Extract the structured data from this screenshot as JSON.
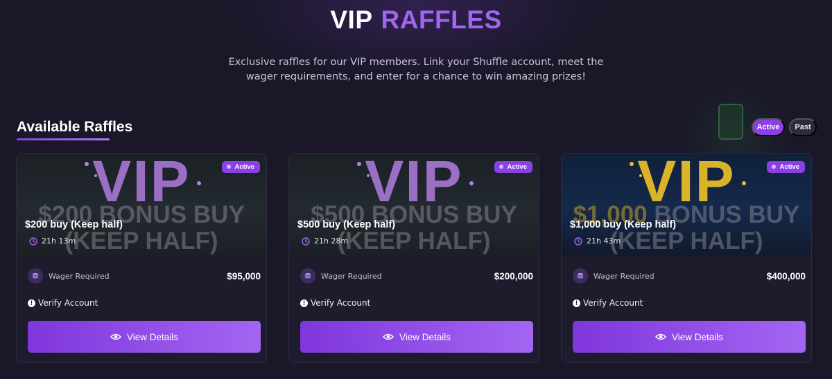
{
  "hero": {
    "title_word1": "VIP",
    "title_word2": "RAFFLES",
    "subtitle": "Exclusive raffles for our VIP members. Link your Shuffle account, meet the wager requirements, and enter for a chance to win amazing prizes!"
  },
  "section": {
    "title": "Available Raffles",
    "filters": {
      "active_label": "Active",
      "past_label": "Past"
    }
  },
  "colors": {
    "accent": "#8b3fe6",
    "background": "#1a1729",
    "card": "#1d1b2c"
  },
  "raffles": [
    {
      "banner_vip": "VIP",
      "banner_amount": "$200",
      "banner_line1": "BONUS BUY",
      "banner_line2": "(KEEP HALF)",
      "status": "Active",
      "name": "$200 buy (Keep half)",
      "time_left": "21h 13m",
      "wager_label": "Wager Required",
      "wager_value": "$95,000",
      "verify_label": "Verify Account",
      "button_label": "View Details",
      "theme": "purple"
    },
    {
      "banner_vip": "VIP",
      "banner_amount": "$500",
      "banner_line1": "BONUS BUY",
      "banner_line2": "(KEEP HALF)",
      "status": "Active",
      "name": "$500 buy (Keep half)",
      "time_left": "21h 28m",
      "wager_label": "Wager Required",
      "wager_value": "$200,000",
      "verify_label": "Verify Account",
      "button_label": "View Details",
      "theme": "purple"
    },
    {
      "banner_vip": "VIP",
      "banner_amount": "$1,000",
      "banner_line1": "BONUS BUY",
      "banner_line2": "(KEEP HALF)",
      "status": "Active",
      "name": "$1,000 buy (Keep half)",
      "time_left": "21h 43m",
      "wager_label": "Wager Required",
      "wager_value": "$400,000",
      "verify_label": "Verify Account",
      "button_label": "View Details",
      "theme": "gold"
    }
  ],
  "icons": {
    "clock": "clock-icon",
    "coin": "coin-stack-icon",
    "alert": "alert-circle-icon",
    "eye": "eye-icon"
  }
}
